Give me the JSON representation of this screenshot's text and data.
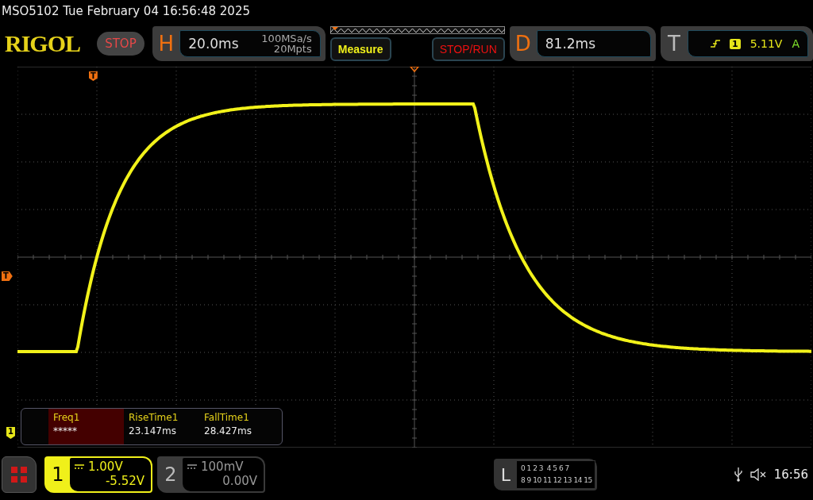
{
  "status_line": "MSO5102  Tue February 04 16:56:48 2025",
  "logo": "RIGOL",
  "run_state": "STOP",
  "horizontal": {
    "label": "H",
    "timebase": "20.0ms",
    "sample_rate": "100MSa/s",
    "memory_depth": "20Mpts"
  },
  "buttons": [
    {
      "label": "Measure",
      "kind": "measure"
    },
    {
      "label": "STOP/RUN",
      "kind": "run"
    }
  ],
  "delay": {
    "label": "D",
    "value": "81.2ms"
  },
  "trigger": {
    "label": "T",
    "source": "1",
    "level": "5.11V",
    "mode": "A"
  },
  "markers": {
    "trigger_position": "T",
    "trigger_level": "T",
    "channel_1": "1"
  },
  "measurements": [
    {
      "name": "Freq1",
      "value": "*****",
      "selected": true
    },
    {
      "name": "RiseTime1",
      "value": "23.147ms",
      "selected": false
    },
    {
      "name": "FallTime1",
      "value": "28.427ms",
      "selected": false
    }
  ],
  "channels": [
    {
      "number": "1",
      "scale": "1.00V",
      "offset": "-5.52V",
      "selected": true
    },
    {
      "number": "2",
      "scale": "100mV",
      "offset": "0.00V",
      "selected": false
    }
  ],
  "logic": {
    "label": "L",
    "rows": [
      "0 1 2 3  4 5 6 7",
      "8 9 10 11 12 13 14 15"
    ]
  },
  "clock": "16:56"
}
